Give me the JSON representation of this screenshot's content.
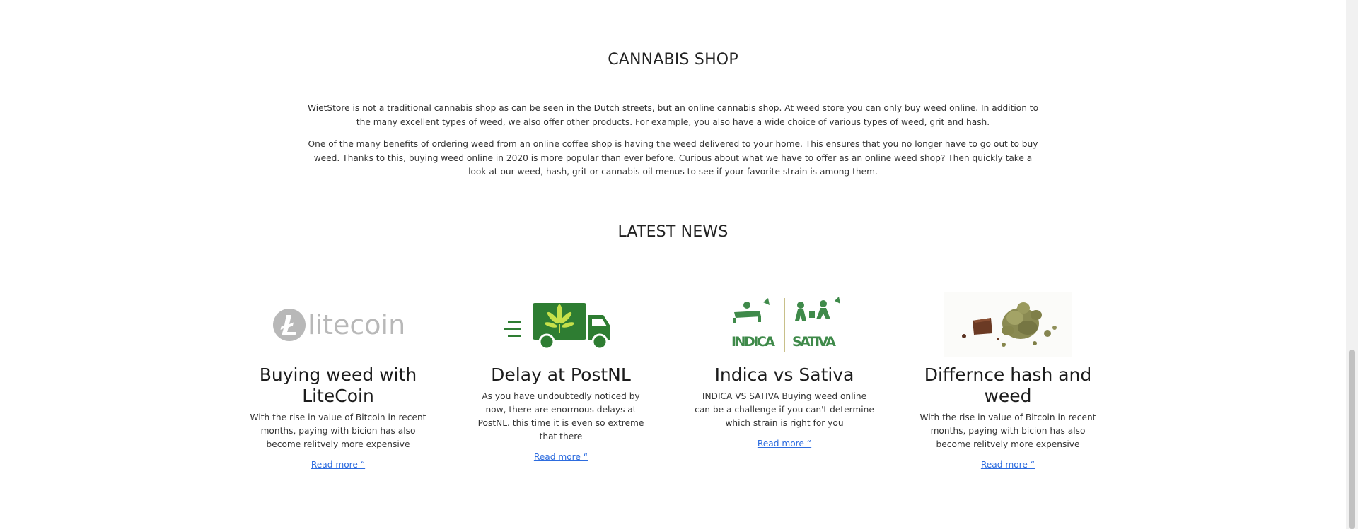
{
  "shop": {
    "title": "CANNABIS SHOP",
    "paragraphs": [
      "WietStore is not a traditional cannabis shop as can be seen in the Dutch streets, but an online cannabis shop. At weed store you can only buy weed online. In addition to the many excellent types of weed, we also offer other products. For example, you also have a wide choice of various types of weed, grit and hash.",
      "One of the many benefits of ordering weed from an online coffee shop is having the weed delivered to your home. This ensures that you no longer have to go out to buy weed. Thanks to this, buying weed online in 2020 is more popular than ever before. Curious about what we have to offer as an online weed shop? Then quickly take a look at our weed, hash, grit or cannabis oil menus to see if your favorite strain is among them."
    ]
  },
  "news": {
    "title": "LATEST NEWS",
    "articles": [
      {
        "image_icon": "litecoin-logo",
        "logo_text": "litecoin",
        "title": "Buying weed with LiteCoin",
        "excerpt": "With the rise in value of Bitcoin in recent months, paying with bicion has also become relitvely more expensive",
        "link": "Read more “"
      },
      {
        "image_icon": "delivery-truck-icon",
        "title": "Delay at PostNL",
        "excerpt": "As you have undoubtedly noticed by now, there are enormous delays at PostNL. this time it is even so extreme that there",
        "link": "Read more “"
      },
      {
        "image_icon": "indica-sativa-image",
        "label_left": "INDICA",
        "label_right": "SATIVA",
        "title": "Indica vs Sativa",
        "excerpt": "INDICA VS SATIVA Buying weed online can be a challenge if you can't determine which strain is right for you",
        "link": "Read more “"
      },
      {
        "image_icon": "hash-and-weed-image",
        "title": "Differnce hash and weed",
        "excerpt": "With the rise in value of Bitcoin in recent months, paying with bicion has also become relitvely more expensive",
        "link": "Read more “"
      }
    ]
  },
  "colors": {
    "link": "#2d6cdf",
    "green": "#2e7d32",
    "litecoin_grey": "#b8b8b8"
  }
}
